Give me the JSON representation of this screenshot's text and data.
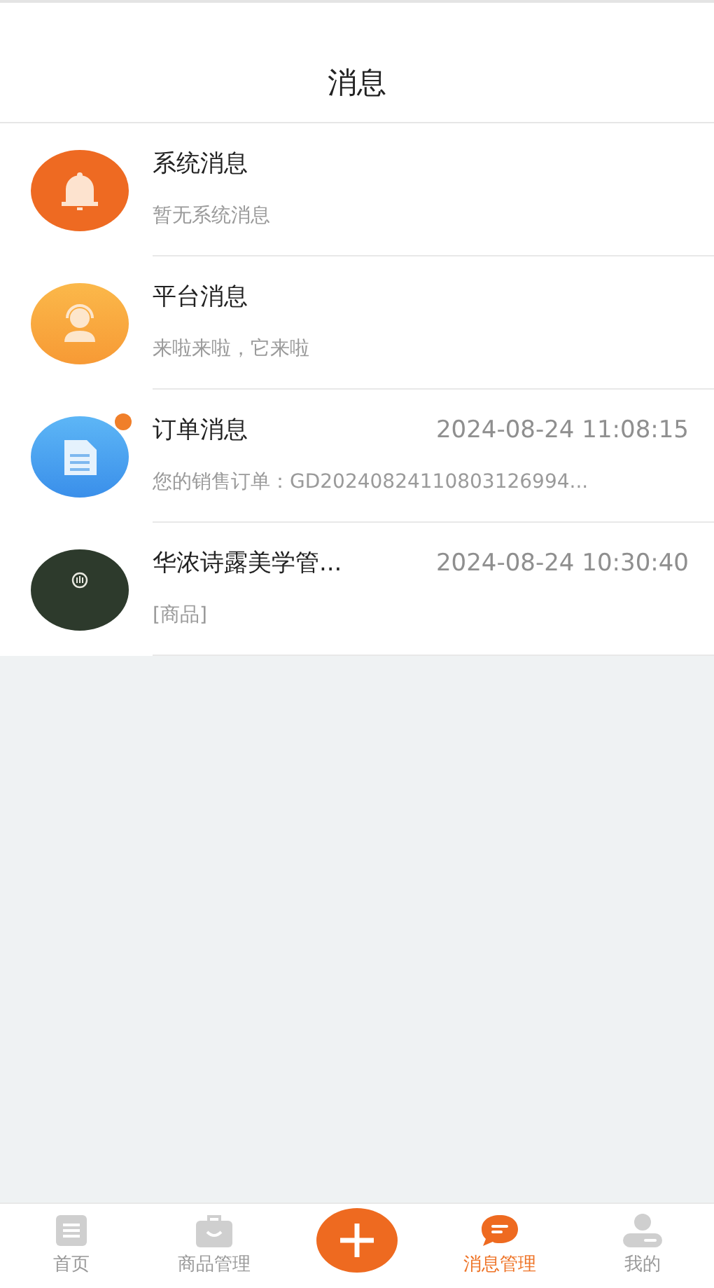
{
  "header": {
    "title": "消息"
  },
  "messages": [
    {
      "kind": "bell",
      "title": "系统消息",
      "preview": "暂无系统消息",
      "unread": false
    },
    {
      "kind": "headset",
      "title": "平台消息",
      "preview": "来啦来啦，它来啦",
      "unread": false
    },
    {
      "kind": "document",
      "title": "订单消息",
      "time": "2024-08-24 11:08:15",
      "preview": "您的销售订单：GD20240824110803126994...",
      "unread": true
    },
    {
      "kind": "logo",
      "title": "华浓诗露美学管...",
      "time": "2024-08-24 10:30:40",
      "preview": "[商品]",
      "unread": false
    }
  ],
  "tab_bar": [
    {
      "kind": "home",
      "label": "首页",
      "selected": false
    },
    {
      "kind": "bag",
      "label": "商品管理",
      "selected": false
    },
    {
      "kind": "add"
    },
    {
      "kind": "chat",
      "label": "消息管理",
      "selected": true
    },
    {
      "kind": "user",
      "label": "我的",
      "selected": false
    }
  ]
}
